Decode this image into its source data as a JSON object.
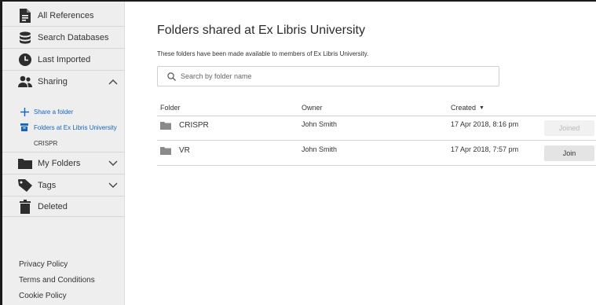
{
  "sidebar": {
    "items": [
      {
        "label": "All References",
        "icon": "document-icon"
      },
      {
        "label": "Search Databases",
        "icon": "database-icon"
      },
      {
        "label": "Last Imported",
        "icon": "clock-icon"
      },
      {
        "label": "Sharing",
        "icon": "people-icon",
        "expanded": true
      },
      {
        "label": "My Folders",
        "icon": "folder-icon",
        "expanded": false
      },
      {
        "label": "Tags",
        "icon": "tag-icon",
        "expanded": false
      },
      {
        "label": "Deleted",
        "icon": "trash-icon"
      }
    ],
    "sharing_sub": [
      {
        "label": "Share a folder",
        "icon": "plus-icon"
      },
      {
        "label": "Folders at Ex Libris University",
        "icon": "archive-icon"
      },
      {
        "label": "CRISPR"
      }
    ],
    "footer": [
      "Privacy Policy",
      "Terms and Conditions",
      "Cookie Policy"
    ]
  },
  "main": {
    "title": "Folders shared at Ex Libris University",
    "subtitle": "These folders have been made available to members of Ex Libris University.",
    "search_placeholder": "Search by folder name",
    "columns": {
      "folder": "Folder",
      "owner": "Owner",
      "created": "Created"
    },
    "sort_indicator": "▼",
    "rows": [
      {
        "folder": "CRISPR",
        "owner": "John Smith",
        "created": "17 Apr 2018, 8:16 pm",
        "action": "Joined",
        "action_enabled": false
      },
      {
        "folder": "VR",
        "owner": "John Smith",
        "created": "17 Apr 2018, 7:57 pm",
        "action": "Join",
        "action_enabled": true
      }
    ]
  },
  "colors": {
    "link": "#1565c0",
    "sidebar_bg": "#eeeeee",
    "icon": "#2d2d2d"
  }
}
